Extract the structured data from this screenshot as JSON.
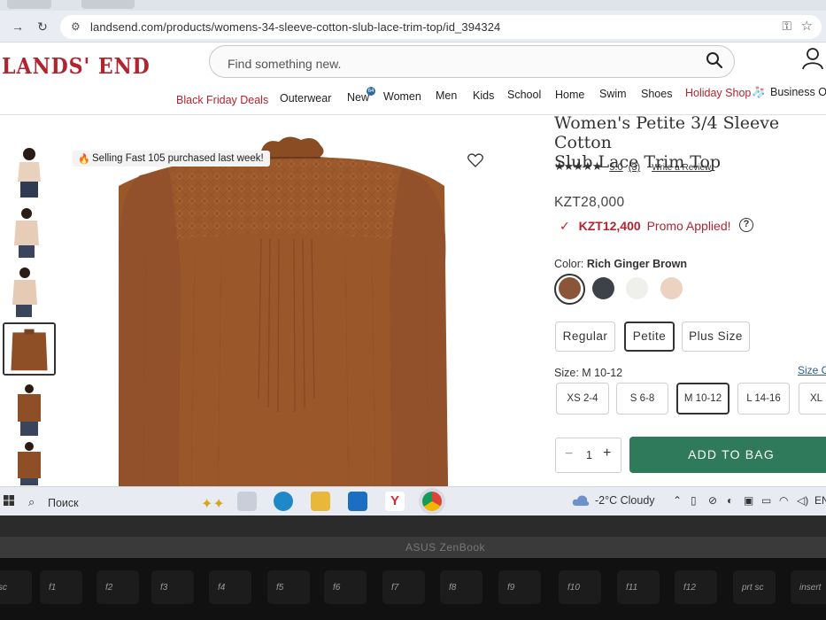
{
  "browser": {
    "url": "landsend.com/products/womens-34-sleeve-cotton-slub-lace-trim-top/id_394324",
    "back_icon": "arrow-right",
    "reload_icon": "reload"
  },
  "site": {
    "logo_text": "LANDS' END",
    "search_placeholder": "Find something new.",
    "nav": [
      {
        "label": "Black Friday Deals",
        "highlight": true
      },
      {
        "label": "Outerwear"
      },
      {
        "label": "New"
      },
      {
        "label": "Women"
      },
      {
        "label": "Men"
      },
      {
        "label": "Kids"
      },
      {
        "label": "School"
      },
      {
        "label": "Home"
      },
      {
        "label": "Swim"
      },
      {
        "label": "Shoes"
      },
      {
        "label": "Holiday Shop",
        "highlight": true
      },
      {
        "label": "Business Ou"
      }
    ],
    "new_badge": "64"
  },
  "gallery": {
    "badge_text": "Selling Fast 105 purchased last week!",
    "thumbnail_count": 6,
    "selected_thumbnail_index": 3
  },
  "product": {
    "title_line1": "Women's Petite 3/4 Sleeve Cotton",
    "title_line2": "Slub Lace Trim Top",
    "stars": "★★★★★",
    "rating": "5.0",
    "review_count": "(3)",
    "write_review": "Write a Review",
    "price": "KZT28,000",
    "promo_price": "KZT12,400",
    "promo_text": "Promo Applied!",
    "color_label": "Color:",
    "color_value": "Rich Ginger Brown",
    "swatches": [
      "#8a5538",
      "#3d4148",
      "#efefec",
      "#ecd3c1"
    ],
    "selected_swatch_index": 0,
    "fits": [
      "Regular",
      "Petite",
      "Plus Size"
    ],
    "selected_fit_index": 1,
    "size_label": "Size:",
    "size_value": "M 10-12",
    "size_chart_link": "Size C",
    "sizes": [
      "XS 2-4",
      "S 6-8",
      "M 10-12",
      "L 14-16",
      "XL"
    ],
    "selected_size_index": 2,
    "quantity": "1",
    "add_to_bag": "ADD TO BAG"
  },
  "taskbar": {
    "search_text": "Поиск",
    "weather": "-2°C  Cloudy",
    "lang": "EN"
  },
  "laptop": {
    "brand": "ASUS ZenBook",
    "keys": [
      "sc",
      "f1",
      "f2",
      "f3",
      "f4",
      "f5",
      "f6",
      "f7",
      "f8",
      "f9",
      "f10",
      "f11",
      "f12",
      "prt sc",
      "insert"
    ]
  },
  "colors": {
    "brand_red": "#b3232e",
    "cta_green": "#2f7a5b",
    "shirt_brown": "#9c5a2c"
  }
}
